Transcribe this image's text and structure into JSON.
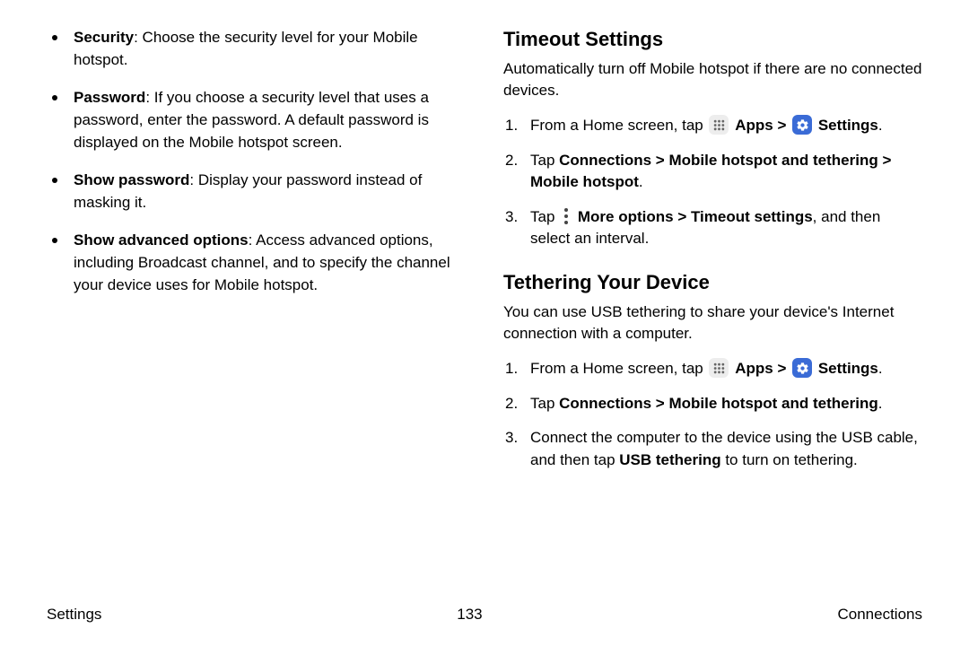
{
  "left": {
    "bullets": [
      {
        "term": "Security",
        "desc": ": Choose the security level for your Mobile hotspot."
      },
      {
        "term": "Password",
        "desc": ": If you choose a security level that uses a password, enter the password. A default password is displayed on the Mobile hotspot screen."
      },
      {
        "term": "Show password",
        "desc": ": Display your password instead of masking it."
      },
      {
        "term": "Show advanced options",
        "desc": ": Access advanced options, including Broadcast channel, and to specify the channel your device uses for Mobile hotspot."
      }
    ]
  },
  "right": {
    "timeout": {
      "heading": "Timeout Settings",
      "intro": "Automatically turn off Mobile hotspot if there are no connected devices.",
      "step1_prefix": "From a Home screen, tap ",
      "apps_label": "Apps",
      "arrow": " > ",
      "settings_label": "Settings",
      "period": ".",
      "step2_prefix": "Tap ",
      "step2_path": "Connections > Mobile hotspot and tethering > Mobile hotspot",
      "step3_prefix": "Tap ",
      "step3_path": "More options > Timeout settings",
      "step3_tail": ", and then select an interval."
    },
    "tether": {
      "heading": "Tethering Your Device",
      "intro": "You can use USB tethering to share your device's Internet connection with a computer.",
      "step1_prefix": "From a Home screen, tap ",
      "apps_label": "Apps",
      "arrow": " > ",
      "settings_label": "Settings",
      "period": ".",
      "step2_prefix": "Tap ",
      "step2_path": "Connections > Mobile hotspot and tethering",
      "step3_a": "Connect the computer to the device using the USB cable, and then tap ",
      "step3_bold": "USB tethering",
      "step3_b": " to turn on tethering."
    }
  },
  "footer": {
    "left": "Settings",
    "center": "133",
    "right": "Connections"
  }
}
